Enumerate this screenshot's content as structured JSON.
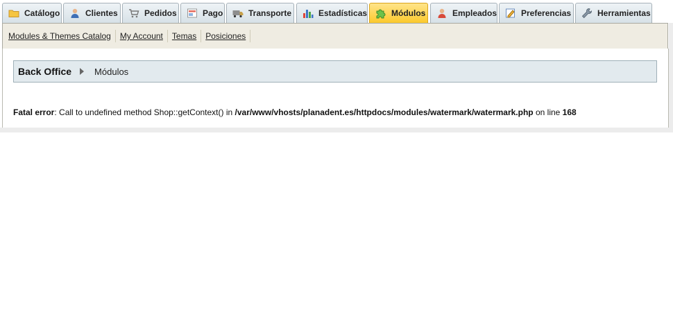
{
  "tabs": [
    {
      "label": "Catálogo",
      "icon": "folder-icon"
    },
    {
      "label": "Clientes",
      "icon": "customer-icon"
    },
    {
      "label": "Pedidos",
      "icon": "cart-icon"
    },
    {
      "label": "Pago",
      "icon": "payment-icon"
    },
    {
      "label": "Transporte",
      "icon": "truck-icon"
    },
    {
      "label": "Estadísticas",
      "icon": "bar-chart-icon"
    },
    {
      "label": "Módulos",
      "icon": "puzzle-icon",
      "active": true
    },
    {
      "label": "Empleados",
      "icon": "employee-icon"
    },
    {
      "label": "Preferencias",
      "icon": "preferences-icon"
    },
    {
      "label": "Herramientas",
      "icon": "wrench-icon"
    }
  ],
  "subnav": [
    {
      "label": "Modules & Themes Catalog"
    },
    {
      "label": "My Account"
    },
    {
      "label": "Temas"
    },
    {
      "label": "Posiciones"
    }
  ],
  "breadcrumb": {
    "root": "Back Office",
    "current": "Módulos"
  },
  "error": {
    "title": "Fatal error",
    "message": ": Call to undefined method Shop::getContext() in ",
    "path": "/var/www/vhosts/planadent.es/httpdocs/modules/watermark/watermark.php",
    "line_text": " on line ",
    "line": "168"
  },
  "colors": {
    "active_tab": "#fbc92c",
    "subnav_bg": "#efece2",
    "breadcrumb_bg": "#e2eaee"
  }
}
